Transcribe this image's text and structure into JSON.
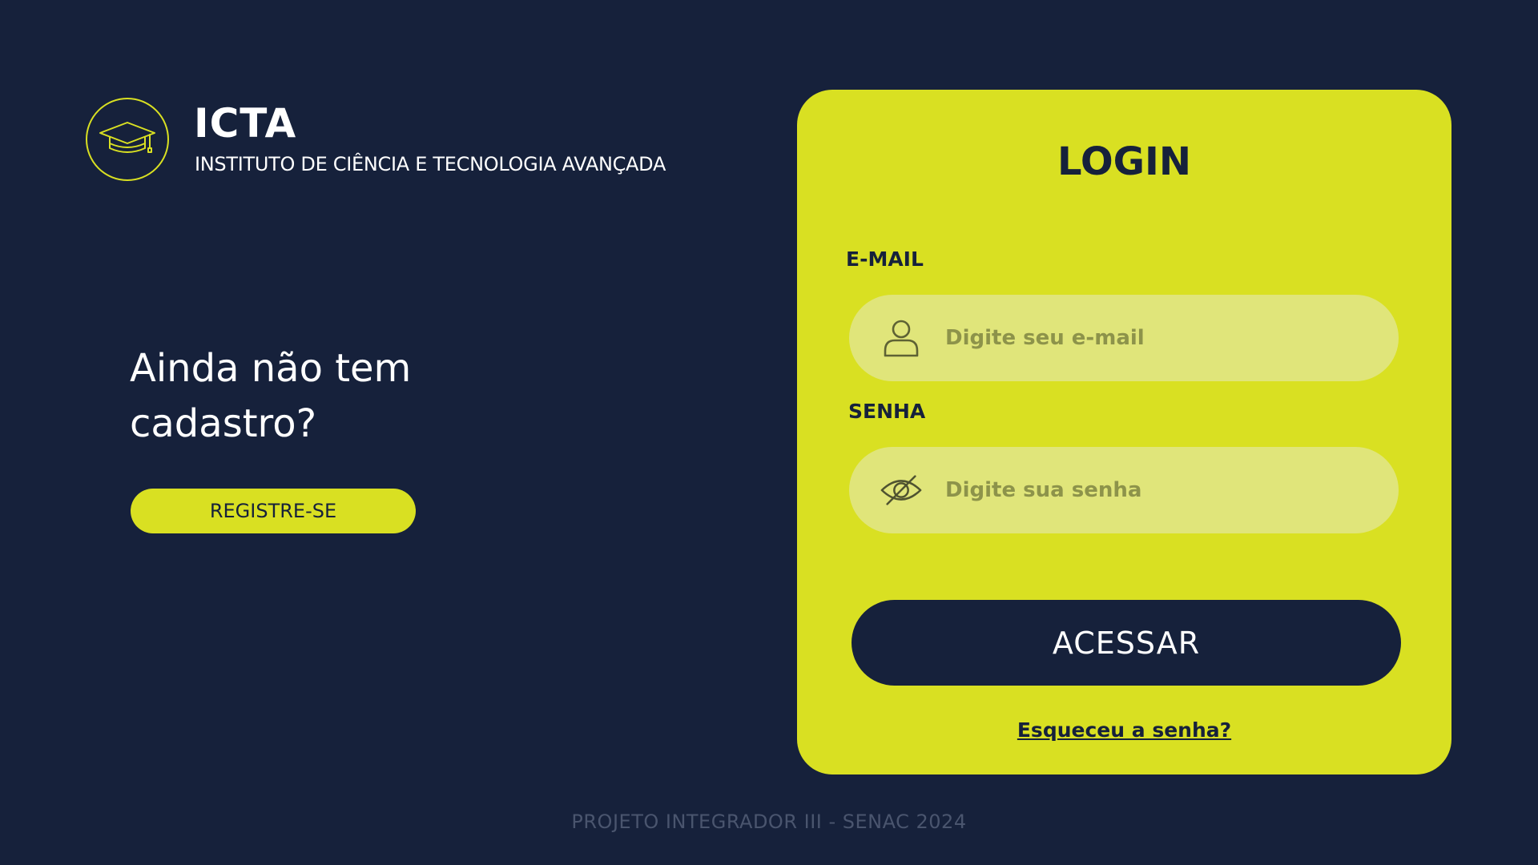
{
  "brand": {
    "logo_icon": "graduation-cap-icon",
    "name": "ICTA",
    "subtitle": "INSTITUTO DE CIÊNCIA E TECNOLOGIA AVANÇADA"
  },
  "signup": {
    "question": "Ainda não tem\ncadastro?",
    "button_label": "REGISTRE-SE"
  },
  "login": {
    "title": "LOGIN",
    "email": {
      "label": "E-MAIL",
      "placeholder": "Digite seu e-mail",
      "value": "",
      "icon": "user-icon"
    },
    "password": {
      "label": "SENHA",
      "placeholder": "Digite sua senha",
      "value": "",
      "icon": "eye-slash-icon"
    },
    "submit_label": "ACESSAR",
    "forgot_label": "Esqueceu a senha?"
  },
  "footer": {
    "text": "PROJETO INTEGRADOR III - SENAC 2024"
  },
  "colors": {
    "background": "#16213b",
    "accent": "#d9e022",
    "input_fill": "#e0e57a",
    "placeholder": "#8d934a",
    "footer_text": "#4a556e"
  }
}
